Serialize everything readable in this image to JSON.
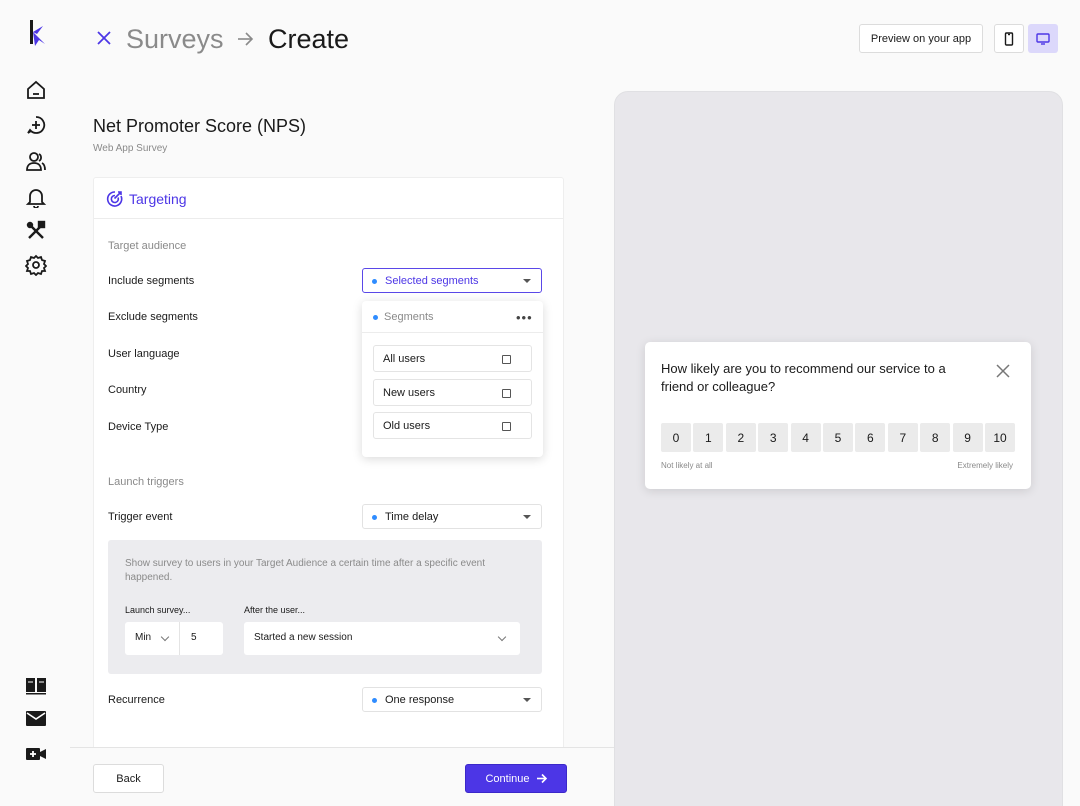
{
  "header": {
    "breadcrumb_parent": "Surveys",
    "breadcrumb_current": "Create",
    "preview_button": "Preview on your app"
  },
  "survey": {
    "title": "Net Promoter Score (NPS)",
    "subtitle": "Web App Survey"
  },
  "targeting": {
    "title": "Targeting",
    "target_audience_label": "Target audience",
    "rows": {
      "include_segments": "Include segments",
      "exclude_segments": "Exclude segments",
      "user_language": "User language",
      "country": "Country",
      "device_type": "Device Type"
    },
    "include_value": "Selected segments",
    "dropdown": {
      "header": "Segments",
      "more": "•••",
      "items": [
        "All users",
        "New users",
        "Old users"
      ]
    },
    "launch_triggers_label": "Launch triggers",
    "trigger_event_label": "Trigger event",
    "trigger_event_value": "Time delay",
    "panel": {
      "description": "Show survey to users in your Target Audience a certain time after a specific event happened.",
      "launch_label": "Launch survey...",
      "after_label": "After the user...",
      "unit": "Min",
      "amount": "5",
      "event": "Started a new session"
    },
    "recurrence_label": "Recurrence",
    "recurrence_value": "One response"
  },
  "footer": {
    "back": "Back",
    "continue": "Continue"
  },
  "preview": {
    "question": "How likely are you to recommend our service to a friend or colleague?",
    "scale": [
      "0",
      "1",
      "2",
      "3",
      "4",
      "5",
      "6",
      "7",
      "8",
      "9",
      "10"
    ],
    "low_label": "Not likely at all",
    "high_label": "Extremely likely"
  },
  "colors": {
    "accent": "#4c36e6",
    "accent_light": "#dcd8fb",
    "dot": "#2f8cff"
  },
  "icons": {
    "sidebar_top": [
      "home-icon",
      "chat-plus-icon",
      "users-icon",
      "bell-icon",
      "tools-icon",
      "settings-icon"
    ],
    "sidebar_bottom": [
      "book-icon",
      "mail-icon",
      "video-plus-icon"
    ]
  }
}
